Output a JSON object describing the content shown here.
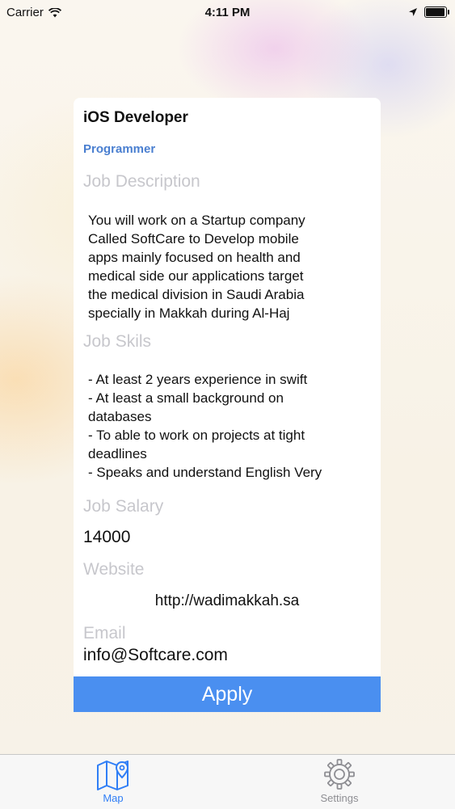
{
  "status_bar": {
    "carrier": "Carrier",
    "time": "4:11 PM",
    "battery_level": 0.95
  },
  "job": {
    "title": "iOS Developer",
    "role": "Programmer",
    "description_label": "Job Description",
    "description": "You will work on a Startup company\nCalled SoftCare to Develop mobile\napps mainly focused on health and\nmedical side our applications target\nthe medical division in Saudi Arabia\nspecially in Makkah during Al-Haj",
    "skills_label": "Job Skils",
    "skills": "- At least 2 years experience in swift\n- At least a small background on\ndatabases\n- To able to work on projects at tight\ndeadlines\n- Speaks and understand English Very",
    "salary_label": "Job Salary",
    "salary": "14000",
    "website_label": "Website",
    "website": "http://wadimakkah.sa",
    "email_label": "Email",
    "email": "info@Softcare.com"
  },
  "apply_label": "Apply",
  "tabs": [
    {
      "label": "Map",
      "icon": "map-icon",
      "selected": true
    },
    {
      "label": "Settings",
      "icon": "gear-icon",
      "selected": false
    }
  ],
  "colors": {
    "accent": "#2f7ef6",
    "apply_button": "#4a8ff0",
    "role_text": "#4a7fd0",
    "label_gray": "#c7c7cc"
  }
}
